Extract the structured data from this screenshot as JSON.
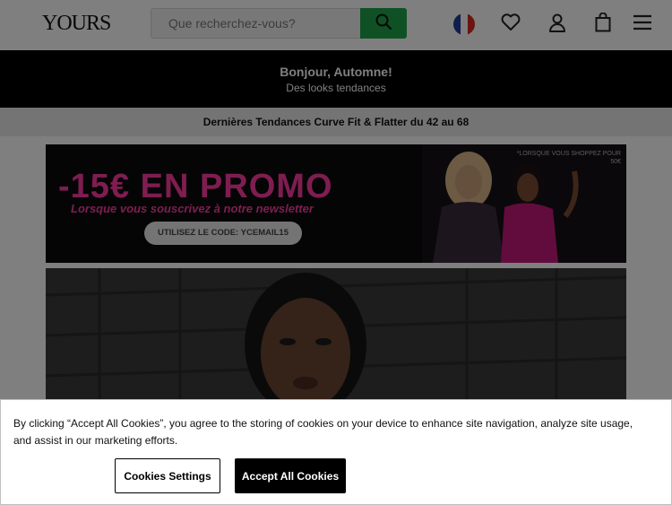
{
  "header": {
    "logo": "YOURS",
    "search_placeholder": "Que recherchez-vous?"
  },
  "announcement": {
    "title": "Bonjour, Automne!",
    "subtitle": "Des looks tendances"
  },
  "trend_bar": {
    "text": "Dernières Tendances Curve  Fit & Flatter du 42 au 68"
  },
  "promo": {
    "headline": "-15€ EN PROMO",
    "subline": "Lorsque vous souscrivez à notre newsletter",
    "code": "UTILISEZ LE CODE: YCEMAIL15",
    "note": "*LORSQUE VOUS SHOPPEZ POUR 50€"
  },
  "cookie_banner": {
    "text": "By clicking “Accept All Cookies”, you agree to the storing of cookies on your device to enhance site navigation, analyze site usage, and assist in our marketing efforts.",
    "settings_label": "Cookies Settings",
    "accept_label": "Accept All Cookies"
  },
  "colors": {
    "brand_green": "#1fa24a",
    "promo_pink": "#ff3aa3",
    "black": "#000000"
  },
  "icons": [
    "search-icon",
    "france-flag-icon",
    "heart-icon",
    "user-icon",
    "bag-icon",
    "menu-icon"
  ]
}
